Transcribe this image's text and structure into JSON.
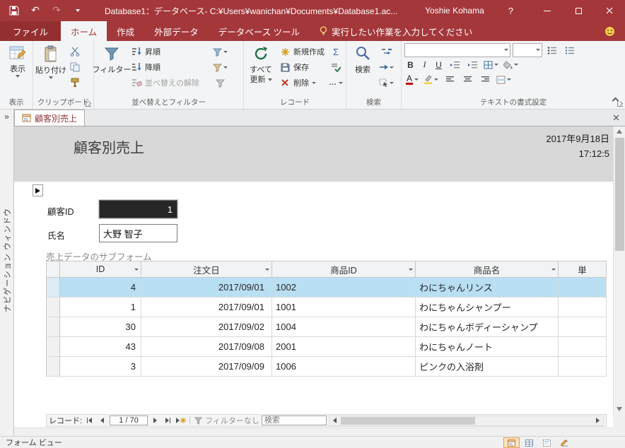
{
  "titlebar": {
    "title": "Database1：データベース- C:¥Users¥wanichan¥Documents¥Database1.ac...",
    "user": "Yoshie Kohama",
    "help": "?"
  },
  "tabs": {
    "file": "ファイル",
    "home": "ホーム",
    "create": "作成",
    "external": "外部データ",
    "tools": "データベース ツール",
    "tellme": "実行したい作業を入力してください"
  },
  "ribbon": {
    "views": {
      "button": "表示",
      "label": "表示"
    },
    "clipboard": {
      "paste": "貼り付け",
      "label": "クリップボード"
    },
    "sort": {
      "filter": "フィルター",
      "asc": "昇順",
      "desc": "降順",
      "clear": "並べ替えの解除",
      "label": "並べ替えとフィルター"
    },
    "records": {
      "refresh_top": "すべて",
      "refresh_bottom": "更新",
      "new": "新規作成",
      "save": "保存",
      "del": "削除",
      "label": "レコード"
    },
    "find": {
      "find": "検索",
      "label": "検索"
    },
    "textfmt": {
      "bold": "B",
      "italic": "I",
      "underline": "U",
      "fontcolor": "A",
      "label": "テキストの書式設定"
    }
  },
  "icons": {
    "undo": "↶",
    "redo": "↷",
    "chevrons": "»",
    "sigma": "Σ",
    "more": "…"
  },
  "navpane": {
    "label": "ナビゲーション ウィンドウ"
  },
  "document": {
    "tab": "顧客別売上"
  },
  "form": {
    "title": "顧客別売上",
    "date": "2017年9月18日",
    "time": "17:12:5",
    "customer_id_label": "顧客ID",
    "customer_id_value": "1",
    "name_label": "氏名",
    "name_value": "大野 智子",
    "subform_caption": "売上データのサブフォーム"
  },
  "subform": {
    "columns": [
      "ID",
      "注文日",
      "商品ID",
      "商品名",
      "単"
    ],
    "rows": [
      {
        "id": "4",
        "order_date": "2017/09/01",
        "product_id": "1002",
        "product_name": "わにちゃんリンス"
      },
      {
        "id": "1",
        "order_date": "2017/09/01",
        "product_id": "1001",
        "product_name": "わにちゃんシャンプー"
      },
      {
        "id": "30",
        "order_date": "2017/09/02",
        "product_id": "1004",
        "product_name": "わにちゃんボディーシャンプ"
      },
      {
        "id": "43",
        "order_date": "2017/09/08",
        "product_id": "2001",
        "product_name": "わにちゃんノート"
      },
      {
        "id": "3",
        "order_date": "2017/09/09",
        "product_id": "1006",
        "product_name": "ピンクの入浴剤"
      }
    ],
    "nav": {
      "record": "レコード:",
      "position": "1 / 70",
      "filter": "フィルターなし",
      "search": "検索"
    }
  },
  "statusbar": {
    "view": "フォーム ビュー"
  },
  "colors": {
    "accent": "#A4373A",
    "selection": "#B9DFF3"
  }
}
